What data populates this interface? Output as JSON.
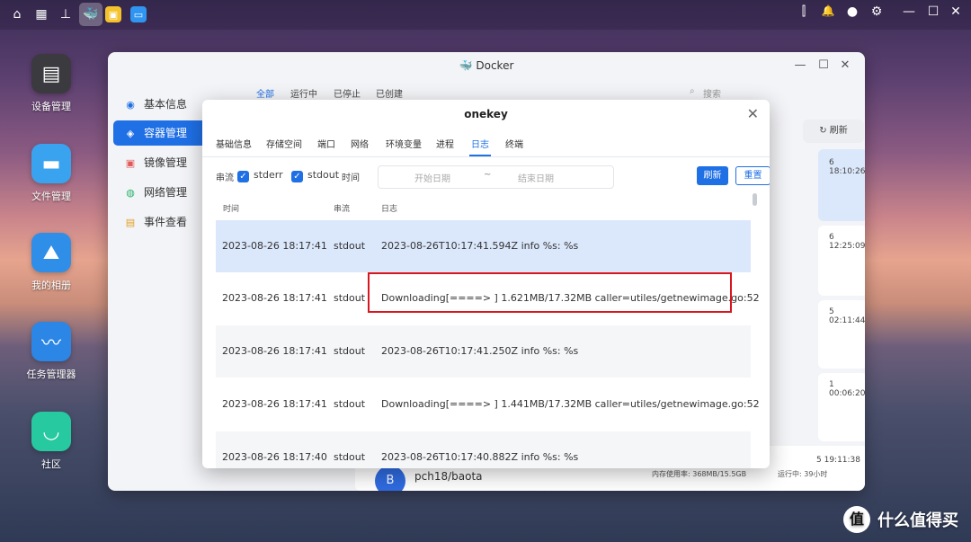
{
  "taskbar": {
    "left_icons": [
      {
        "icon": "home-icon",
        "glyph": "⌂"
      },
      {
        "icon": "apps-grid-icon",
        "glyph": "▦"
      },
      {
        "icon": "network-icon",
        "glyph": "⊥"
      },
      {
        "icon": "docker-icon",
        "glyph": "🐳"
      },
      {
        "icon": "notes-icon",
        "glyph": "▣"
      },
      {
        "icon": "window-icon",
        "glyph": "▭"
      }
    ],
    "right_icons": [
      {
        "icon": "equalizer-icon",
        "glyph": "⫿"
      },
      {
        "icon": "bell-icon",
        "glyph": "🔔"
      },
      {
        "icon": "user-icon",
        "glyph": "●"
      },
      {
        "icon": "gear-icon",
        "glyph": "⚙"
      },
      {
        "icon": "minimize-icon",
        "glyph": "—"
      },
      {
        "icon": "maximize-icon",
        "glyph": "☐"
      },
      {
        "icon": "close-icon",
        "glyph": "✕"
      }
    ]
  },
  "desktop": {
    "items": [
      {
        "label": "设备管理",
        "icon": "device-manager-icon",
        "glyph": "▤",
        "color": "#3a3a3f"
      },
      {
        "label": "文件管理",
        "icon": "folder-icon",
        "glyph": "▬",
        "color": "#3aa3f0"
      },
      {
        "label": "我的相册",
        "icon": "photos-icon",
        "glyph": "⛰",
        "color": "#2f8ee8"
      },
      {
        "label": "任务管理器",
        "icon": "task-manager-icon",
        "glyph": "〰",
        "color": "#2b86e6"
      },
      {
        "label": "社区",
        "icon": "community-icon",
        "glyph": "◡",
        "color": "#27c9a0"
      }
    ]
  },
  "docker": {
    "title": "Docker",
    "sidebar": [
      {
        "label": "基本信息",
        "icon": "info-icon",
        "glyph": "◉"
      },
      {
        "label": "容器管理",
        "icon": "container-icon",
        "glyph": "◈"
      },
      {
        "label": "镜像管理",
        "icon": "image-icon",
        "glyph": "▣"
      },
      {
        "label": "网络管理",
        "icon": "network-icon",
        "glyph": "◍"
      },
      {
        "label": "事件查看",
        "icon": "event-icon",
        "glyph": "▤"
      }
    ],
    "tabs": [
      "全部",
      "运行中",
      "已停止",
      "已创建"
    ],
    "search_placeholder": "搜索",
    "refresh_label": "刷新",
    "bg_times": [
      "6 18:10:26",
      "6 12:25:09",
      "5 02:11:44",
      "1 00:06:20",
      "5 19:11:38"
    ],
    "bg_container": {
      "avatar": "B",
      "name": "pch18/baota",
      "memory": "内存使用率: 368MB/15.5GB",
      "status": "运行中: 39小时"
    }
  },
  "modal": {
    "title": "onekey",
    "tabs": [
      "基础信息",
      "存储空间",
      "端口",
      "网络",
      "环境变量",
      "进程",
      "日志",
      "终端"
    ],
    "active_tab": "日志",
    "filter": {
      "stream_label": "串流",
      "stderr_label": "stderr",
      "stdout_label": "stdout",
      "time_label": "时间",
      "start_placeholder": "开始日期",
      "separator": "~",
      "end_placeholder": "结束日期",
      "refresh_button": "刷新",
      "reset_button": "重置"
    },
    "columns": {
      "time": "时间",
      "stream": "串流",
      "log": "日志"
    },
    "rows": [
      {
        "time": "2023-08-26 18:17:41",
        "stream": "stdout",
        "log": "2023-08-26T10:17:41.594Z info %s: %s"
      },
      {
        "time": "2023-08-26 18:17:41",
        "stream": "stdout",
        "log": "Downloading[====> ] 1.621MB/17.32MB caller=utiles/getnewimage.go:52"
      },
      {
        "time": "2023-08-26 18:17:41",
        "stream": "stdout",
        "log": "2023-08-26T10:17:41.250Z info %s: %s"
      },
      {
        "time": "2023-08-26 18:17:41",
        "stream": "stdout",
        "log": "Downloading[====> ] 1.441MB/17.32MB caller=utiles/getnewimage.go:52"
      },
      {
        "time": "2023-08-26 18:17:40",
        "stream": "stdout",
        "log": "2023-08-26T10:17:40.882Z info %s: %s"
      }
    ]
  },
  "watermark": {
    "logo": "值",
    "text": "什么值得买"
  },
  "colors": {
    "accent": "#1f6fe5",
    "highlight_border": "#d9161d",
    "row_selected": "#dbe8fb",
    "row_alt": "#f5f6f8"
  }
}
